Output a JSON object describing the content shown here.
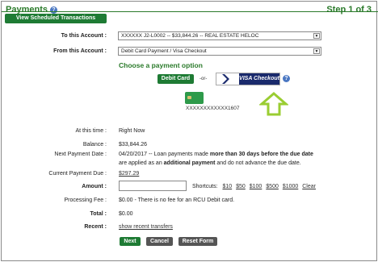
{
  "header": {
    "title": "Payments",
    "step": "Step 1 of 3"
  },
  "view_scheduled": "View Scheduled Transactions",
  "to_account": {
    "label": "To this Account :",
    "value": "XXXXXX    J2-L0002  --  $33,844.26  --  REAL ESTATE HELOC"
  },
  "from_account": {
    "label": "From this Account :",
    "value": "Debit Card Payment / Visa Checkout"
  },
  "payment_option": {
    "heading": "Choose a payment option",
    "debit_label": "Debit Card",
    "or_text": "-or-",
    "visa_text": "VISA Checkout",
    "card_number": "XXXXXXXXXXXX1607"
  },
  "rows": {
    "time": {
      "label": "At this time :",
      "value": "Right Now"
    },
    "balance": {
      "label": "Balance :",
      "value": "$33,844.26"
    },
    "next_date": {
      "label": "Next Payment Date :",
      "line1_a": "04/20/2017  -- Loan payments made ",
      "line1_b": "more than 30 days before the due date",
      "line2_a": "are applied as an ",
      "line2_b": "additional payment",
      "line2_c": " and do not advance the due date."
    },
    "current_due": {
      "label": "Current Payment Due :",
      "value": "$297.29"
    },
    "amount": {
      "label": "Amount :",
      "shortcuts_label": "Shortcuts:",
      "shortcuts": [
        "$10",
        "$50",
        "$100",
        "$500",
        "$1000",
        "Clear"
      ]
    },
    "fee": {
      "label": "Processing Fee :",
      "value": "$0.00   - There is no fee for an RCU Debit card."
    },
    "total": {
      "label": "Total :",
      "value": "$0.00"
    },
    "recent": {
      "label": "Recent :",
      "value": "show recent transfers"
    }
  },
  "actions": {
    "next": "Next",
    "cancel": "Cancel",
    "reset": "Reset Form"
  },
  "colors": {
    "green": "#1e7b34",
    "header_green": "#2a7a2a",
    "arrow": "#9acd32",
    "visa_navy": "#1a2a6c"
  }
}
